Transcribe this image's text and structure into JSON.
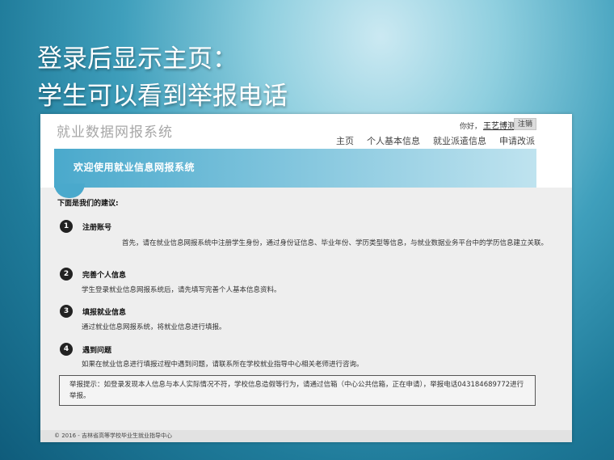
{
  "slide": {
    "title_line1": "登录后显示主页：",
    "title_line2": "学生可以看到举报电话"
  },
  "system": {
    "title": "就业数据网报系统",
    "greeting": "你好，",
    "username": "王艺博测",
    "logout": "注销"
  },
  "nav": {
    "items": [
      "主页",
      "个人基本信息",
      "就业派遣信息",
      "申请改派"
    ]
  },
  "welcome": {
    "text": "欢迎使用就业信息网报系统"
  },
  "suggestions": {
    "heading": "下面是我们的建议:",
    "steps": [
      {
        "num": "1",
        "title": "注册账号",
        "desc": "首先，请在就业信息网报系统中注册学生身份，通过身份证信息、毕业年份、学历类型等信息，与就业数据业务平台中的学历信息建立关联。"
      },
      {
        "num": "2",
        "title": "完善个人信息",
        "desc": "学生登录就业信息网报系统后，请先填写完善个人基本信息资料。"
      },
      {
        "num": "3",
        "title": "填报就业信息",
        "desc": "通过就业信息网报系统，将就业信息进行填报。"
      },
      {
        "num": "4",
        "title": "遇到问题",
        "desc": "如果在就业信息进行填报过程中遇到问题，请联系所在学校就业指导中心相关老师进行咨询。"
      }
    ]
  },
  "notice": {
    "text": "举报提示：如登录发现本人信息与本人实际情况不符，学校信息造假等行为，请通过信箱（中心公共信箱，正在申请），举报电话043184689772进行举报。"
  },
  "footer": {
    "text": "© 2016 - 吉林省高等学校毕业生就业指导中心"
  }
}
